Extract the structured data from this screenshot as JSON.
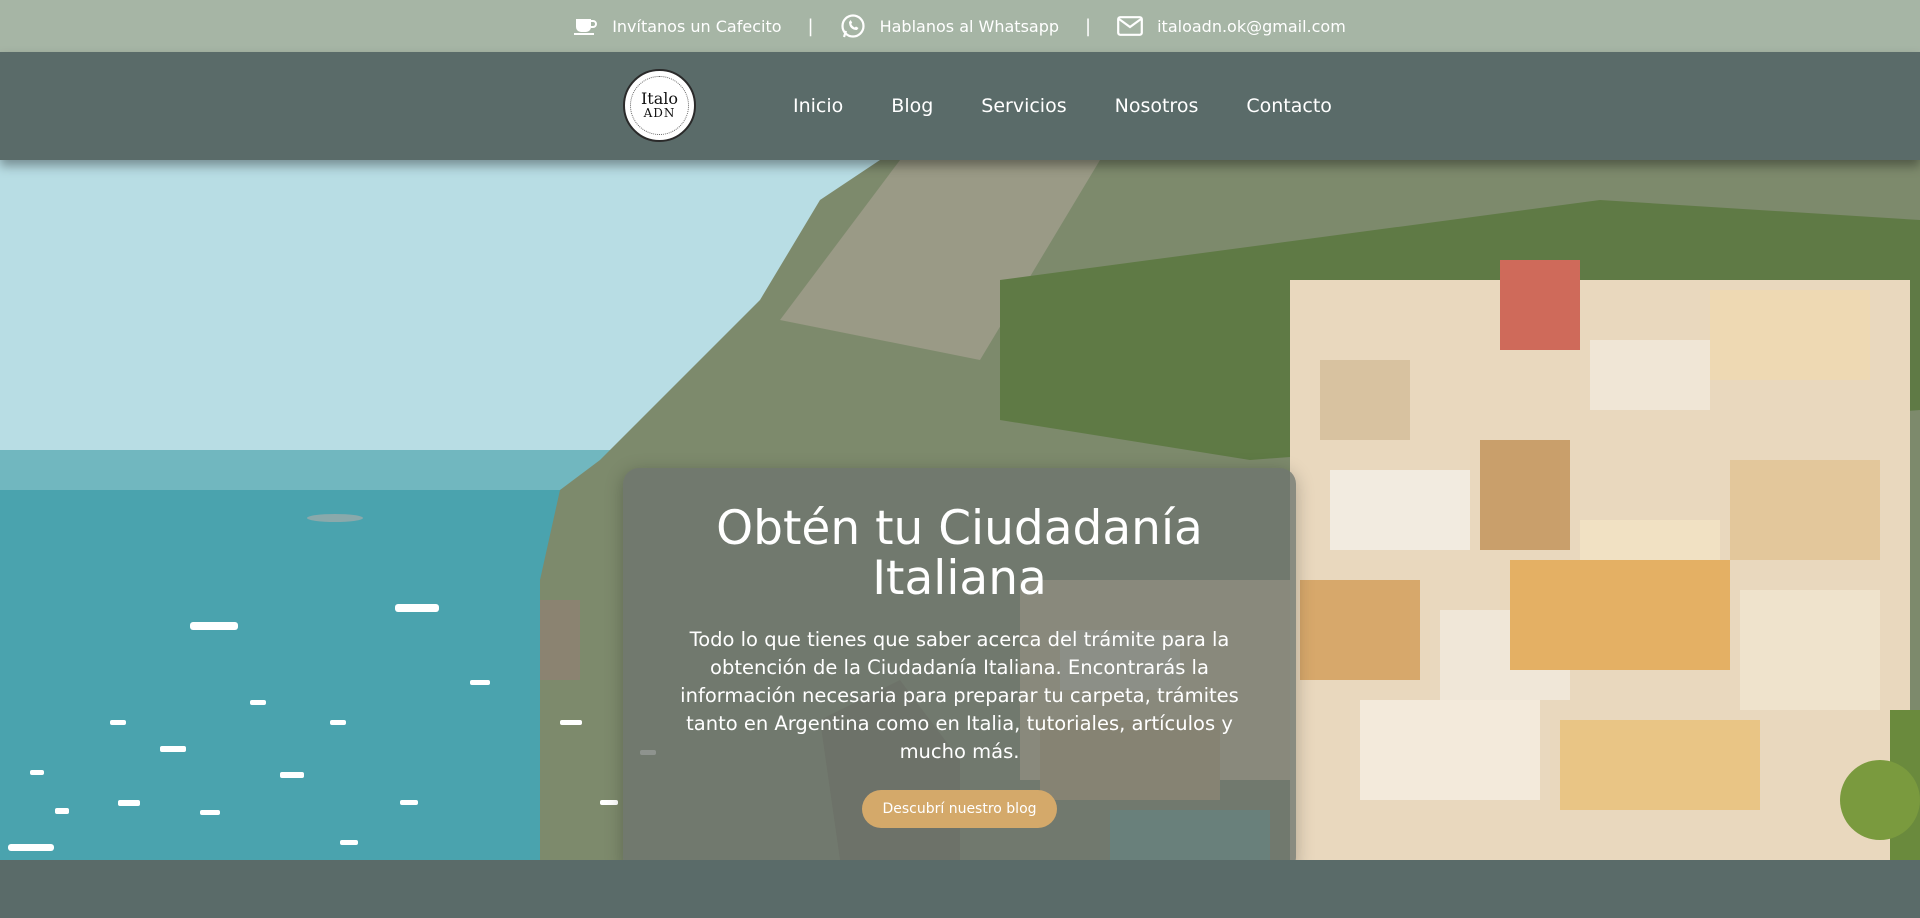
{
  "topbar": {
    "coffee_label": "Invítanos un Cafecito",
    "separator": "|",
    "whatsapp_label": "Hablanos al Whatsapp",
    "email_label": "italoadn.ok@gmail.com"
  },
  "logo": {
    "line1": "Italo",
    "line2": "ADN"
  },
  "nav": {
    "items": [
      {
        "label": "Inicio"
      },
      {
        "label": "Blog"
      },
      {
        "label": "Servicios"
      },
      {
        "label": "Nosotros"
      },
      {
        "label": "Contacto"
      }
    ]
  },
  "hero": {
    "title": "Obtén tu Ciudadanía Italiana",
    "description": "Todo lo que tienes que saber acerca del trámite para la obtención de la Ciudadanía Italiana. Encontrarás la información necesaria para preparar tu carpeta, trámites tanto en Argentina como en Italia, tutoriales, artículos y mucho más.",
    "cta_label": "Descubrí nuestro blog"
  },
  "colors": {
    "topbar_bg": "#a6b5a5",
    "nav_bg": "#5a6b69",
    "cta_bg": "#d4a96a"
  },
  "icons": {
    "coffee": "coffee-cup-icon",
    "whatsapp": "whatsapp-icon",
    "email": "envelope-icon"
  }
}
